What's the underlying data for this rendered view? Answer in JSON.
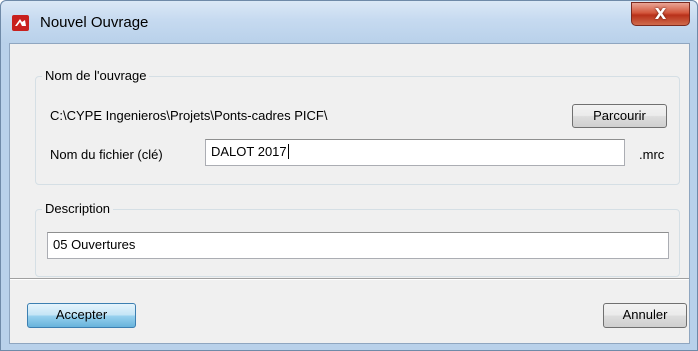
{
  "window": {
    "title": "Nouvel Ouvrage",
    "close_glyph": "X",
    "accent_color": "#c8201e"
  },
  "ouvrage_group": {
    "legend": "Nom de l'ouvrage",
    "path": "C:\\CYPE Ingenieros\\Projets\\Ponts-cadres PICF\\",
    "browse_label": "Parcourir",
    "filename_label": "Nom du fichier (clé)",
    "filename_value": "DALOT 2017",
    "extension": ".mrc"
  },
  "description_group": {
    "legend": "Description",
    "value": "05 Ouvertures"
  },
  "footer": {
    "accept_label": "Accepter",
    "cancel_label": "Annuler"
  },
  "icons": {
    "app": "cype-logo-icon",
    "close": "close-icon"
  }
}
